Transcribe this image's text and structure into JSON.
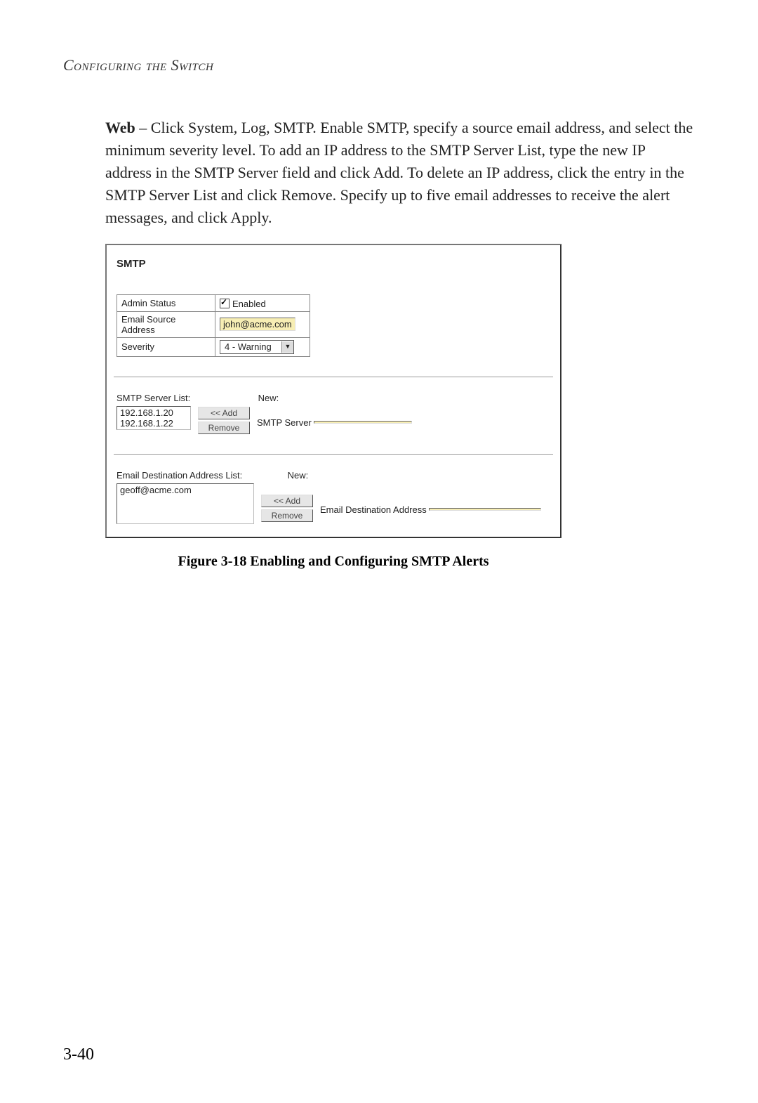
{
  "heading": "Configuring the Switch",
  "paragraph_lead": "Web",
  "paragraph_rest": " – Click System, Log, SMTP. Enable SMTP, specify a source email address, and select the minimum severity level. To add an IP address to the SMTP Server List, type the new IP address in the SMTP Server field and click Add. To delete an IP address, click the entry in the SMTP Server List and click Remove. Specify up to five email addresses to receive the alert messages, and click Apply.",
  "panel": {
    "title": "SMTP",
    "admin_status_label": "Admin Status",
    "enabled_label": "Enabled",
    "admin_status_checked": true,
    "email_source_label": "Email Source Address",
    "email_source_value": "john@acme.com",
    "severity_label": "Severity",
    "severity_value": "4 - Warning",
    "server_list_label": "SMTP Server List:",
    "new_label": "New:",
    "server_list": [
      "192.168.1.20",
      "192.168.1.22"
    ],
    "server_input_label": "SMTP Server",
    "server_input_value": "",
    "dest_list_label": "Email Destination Address List:",
    "dest_list": [
      "geoff@acme.com"
    ],
    "dest_input_label": "Email Destination Address",
    "dest_input_value": "",
    "add_btn": "<< Add",
    "remove_btn": "Remove"
  },
  "figure_caption": "Figure 3-18  Enabling and Configuring SMTP Alerts",
  "page_number": "3-40"
}
